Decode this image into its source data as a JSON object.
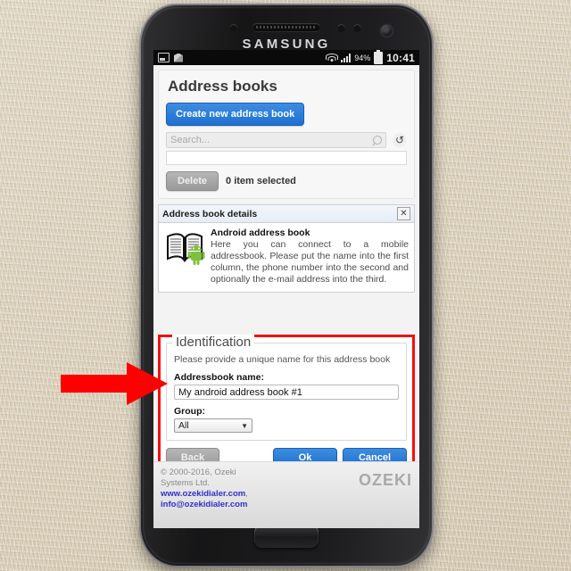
{
  "device": {
    "brand": "SAMSUNG"
  },
  "status_bar": {
    "icons": [
      "screenshot-icon",
      "package-icon",
      "wifi-icon",
      "signal-icon",
      "battery-icon"
    ],
    "battery_percent": "94%",
    "time": "10:41"
  },
  "page": {
    "title": "Address books",
    "create_button": "Create new address book",
    "search_placeholder": "Search...",
    "search_value": "",
    "refresh_icon": "refresh-icon",
    "delete_button": "Delete",
    "selection_status": "0 item selected"
  },
  "details": {
    "header_title": "Address book details",
    "close_icon": "close-icon",
    "icon": "android-address-book-icon",
    "item_title": "Android address book",
    "item_text": "Here you can connect to a mobile addressbook. Please put the name into the first column, the phone number into the second and optionally the e-mail address into the third."
  },
  "identification": {
    "legend": "Identification",
    "hint": "Please provide a unique name for this address book",
    "name_label": "Addressbook name:",
    "name_value": "My android address book #1",
    "group_label": "Group:",
    "group_value": "All",
    "group_options": [
      "All"
    ],
    "buttons": {
      "back": "Back",
      "ok": "Ok",
      "cancel": "Cancel"
    }
  },
  "footer": {
    "copyright_line1": "© 2000-2016, Ozeki",
    "copyright_line2": "Systems Ltd.",
    "website": "www.ozekidialer.com",
    "website_suffix": ",",
    "email": "info@ozekidialer.com",
    "logo": "OZEKI"
  },
  "annotation": {
    "arrow": "red-arrow-pointing-to-addressbook-name-field"
  },
  "colors": {
    "accent_blue": "#2572d4",
    "highlight_red": "#f30f12",
    "link_blue": "#2f2fd0"
  }
}
